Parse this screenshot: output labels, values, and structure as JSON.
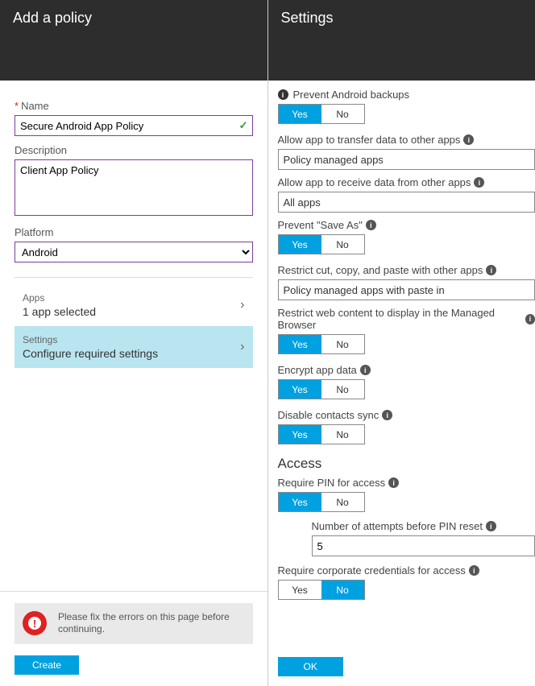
{
  "left": {
    "title": "Add a policy",
    "name": {
      "label": "Name",
      "value": "Secure Android App Policy"
    },
    "description": {
      "label": "Description",
      "value": "Client App Policy"
    },
    "platform": {
      "label": "Platform",
      "value": "Android"
    },
    "apps": {
      "title": "Apps",
      "subtitle": "1 app selected"
    },
    "settings": {
      "title": "Settings",
      "subtitle": "Configure required settings"
    },
    "error": "Please fix the errors on this page before continuing.",
    "createLabel": "Create"
  },
  "right": {
    "title": "Settings",
    "yes": "Yes",
    "no": "No",
    "preventBackups": {
      "label": "Prevent Android backups",
      "value": "Yes"
    },
    "transferTo": {
      "label": "Allow app to transfer data to other apps",
      "value": "Policy managed apps"
    },
    "receiveFrom": {
      "label": "Allow app to receive data from other apps",
      "value": "All apps"
    },
    "preventSaveAs": {
      "label": "Prevent \"Save As\"",
      "value": "Yes"
    },
    "restrictCopy": {
      "label": "Restrict cut, copy, and paste with other apps",
      "value": "Policy managed apps with paste in"
    },
    "restrictWeb": {
      "label": "Restrict web content to display in the Managed Browser",
      "value": "Yes"
    },
    "encrypt": {
      "label": "Encrypt app data",
      "value": "Yes"
    },
    "disableContacts": {
      "label": "Disable contacts sync",
      "value": "Yes"
    },
    "accessHeading": "Access",
    "requirePin": {
      "label": "Require PIN for access",
      "value": "Yes"
    },
    "pinAttempts": {
      "label": "Number of attempts before PIN reset",
      "value": "5"
    },
    "requireCorp": {
      "label": "Require corporate credentials for access",
      "value": "No"
    },
    "okLabel": "OK"
  }
}
